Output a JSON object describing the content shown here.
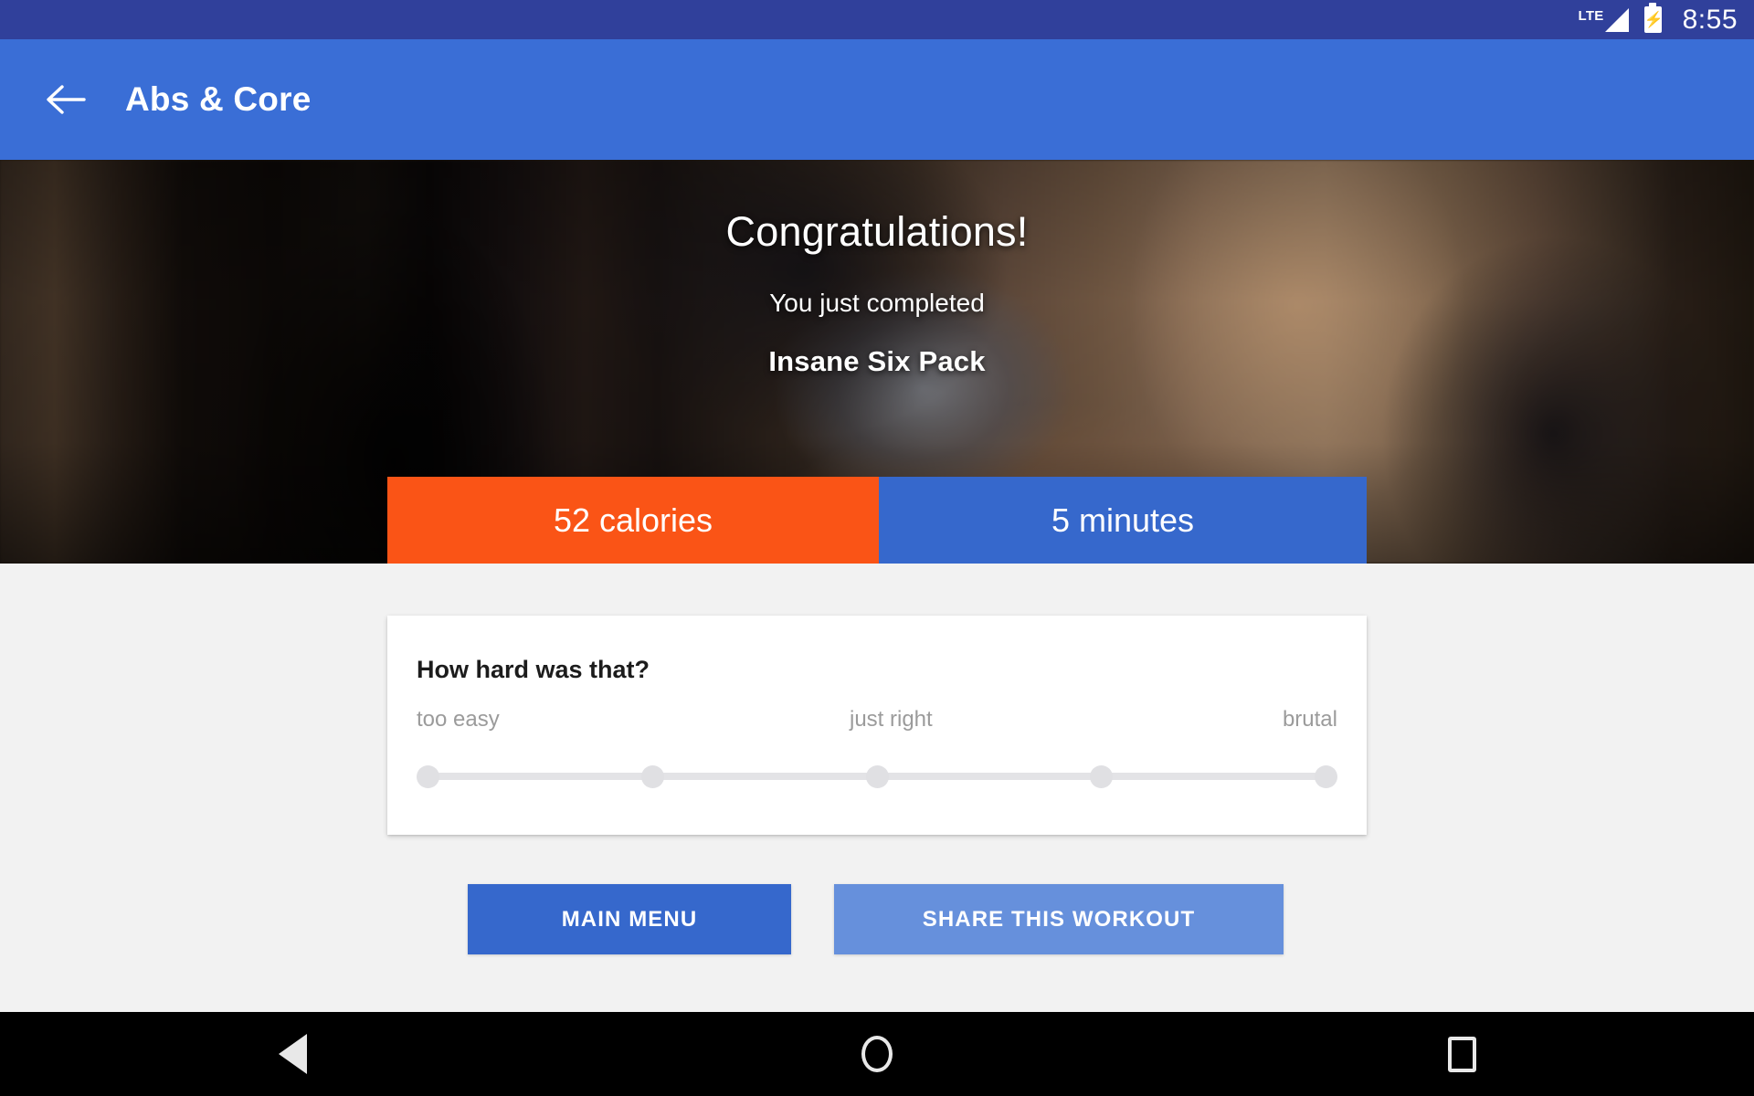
{
  "status_bar": {
    "network_label": "LTE",
    "clock": "8:55",
    "battery_state": "charging",
    "background_color": "#30409B"
  },
  "app_bar": {
    "back_icon": "arrow-left-icon",
    "title": "Abs & Core",
    "background_color": "#3A6ED6"
  },
  "hero": {
    "heading": "Congratulations!",
    "subheading": "You just completed",
    "workout_name": "Insane Six Pack"
  },
  "stats": {
    "calories": {
      "label": "52 calories",
      "value": 52,
      "unit": "calories",
      "color": "#FA5416"
    },
    "duration": {
      "label": "5 minutes",
      "value": 5,
      "unit": "minutes",
      "color": "#3668CC"
    }
  },
  "rating_card": {
    "question": "How hard was that?",
    "scale_labels": {
      "left": "too easy",
      "middle": "just right",
      "right": "brutal"
    },
    "steps": 5,
    "selected": null
  },
  "actions": {
    "main_menu": {
      "label": "MAIN MENU",
      "color": "#3668CC"
    },
    "share": {
      "label": "SHARE THIS WORKOUT",
      "color": "#6690DC"
    }
  },
  "nav_bar": {
    "back_icon": "triangle-back-icon",
    "home_icon": "circle-home-icon",
    "recents_icon": "square-recents-icon",
    "background_color": "#000000"
  }
}
